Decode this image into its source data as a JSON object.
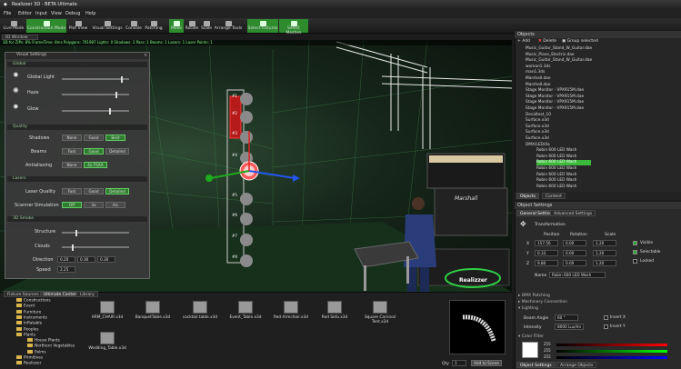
{
  "window": {
    "title": "Realizzer 3D - BETA Ultimate"
  },
  "menu": [
    "File",
    "Editor",
    "Input",
    "View",
    "Debug",
    "Help"
  ],
  "toolbar": {
    "buttons": [
      "Live Mode",
      "Construction Mode",
      "Plot View",
      "Visual Settings",
      "Console",
      "Patching",
      "Move",
      "Rotate",
      "Scale",
      "Arrange Tools",
      "Select Fixtures",
      "Select Meshes"
    ]
  },
  "viewport": {
    "tab": "3D Window",
    "status": "3D for ZIPs: 8% FrameTime: 8ms  Polygons: 701987  Lights: 0  Shadows: 3  Pass: 1  Beams: 1  Lasers: 1  Laser Points: 1",
    "logo_text": "Realizzer",
    "brand_text": "Marshall"
  },
  "visual_settings": {
    "title": "Visual Settings",
    "global_header": "Global",
    "global_labels": [
      "Global Light",
      "Haze",
      "Glow"
    ],
    "global_levels": [
      0.88,
      0.8,
      0.7
    ],
    "quality_header": "Quality",
    "shadows_label": "Shadows",
    "shadows_opts": [
      "None",
      "Good",
      "Best"
    ],
    "beams_label": "Beams",
    "beams_opts": [
      "Fast",
      "Good",
      "Detailed"
    ],
    "aa_label": "Antialiasing",
    "aa_opts": [
      "None",
      "4x FSAA"
    ],
    "lasers_header": "Lasers",
    "laser_quality_label": "Laser Quality",
    "laser_quality_opts": [
      "Fast",
      "Good",
      "Detailed"
    ],
    "scanner_label": "Scanner Simulation",
    "scanner_opts": [
      "Off",
      "3x",
      "Hx"
    ],
    "smoke_header": "3D Smoke",
    "smoke_labels": [
      "Structure",
      "Clouds",
      "Direction",
      "Speed"
    ],
    "direction_values": [
      "0.20",
      "0.30",
      "0.30"
    ],
    "speed_value": "2.25"
  },
  "objects": {
    "title": "Objects",
    "actions": [
      "Add",
      "Delete",
      "Group selected"
    ],
    "items": [
      "Music_Guitar_Stand_W_Guitar.dae",
      "Music_Piano_Electric.dae",
      "Music_Guitar_Stand_W_Guitar.dae",
      "woman1.3ds",
      "man1.3ds",
      "Marshall.dae",
      "Marshall.dae",
      "Stage Monitor - VPX915M.dae",
      "Stage Monitor - VPX915M.dae",
      "Stage Monitor - VPX915M.dae",
      "Stage Monitor - VPX915M.dae",
      "Decaltest_10",
      "Surface.x3d",
      "Surface.x3d",
      "Surface.x3d",
      "Surface.x3d",
      "DMX/LED/4a",
      "Robin 600 LED Wash",
      "Robin 600 LED Wash",
      "Robin 600 LED Wash",
      "Robin 600 LED Wash",
      "Robin 600 LED Wash",
      "Robin 600 LED Wash",
      "Robin 600 LED Wash"
    ],
    "selected_index": 19,
    "tabs": [
      "Objects",
      "Content"
    ]
  },
  "object_settings": {
    "title": "Object Settings",
    "tabs": [
      "General Settings",
      "Advanced Settings"
    ],
    "transformation_label": "Transformation",
    "col_headers": [
      "Position",
      "Rotation",
      "Scale"
    ],
    "axes": [
      "X",
      "Y",
      "Z"
    ],
    "position": [
      "157.56",
      "0.33",
      "9.80"
    ],
    "rotation": [
      "0.00",
      "0.00",
      "0.00"
    ],
    "scale": [
      "1.20",
      "1.20",
      "1.20"
    ],
    "checks": [
      "Visible",
      "Selectable",
      "Locked"
    ],
    "name_label": "Name",
    "name_value": "Robin 600 LED Wash",
    "collapsed_sections": [
      "DMX Patching",
      "Machinery Connection",
      "Lighting"
    ],
    "beam_angle_label": "Beam Angle",
    "beam_angle_value": "60 °",
    "intensity_label": "Intensity",
    "intensity_value": "8000 Lux/lm",
    "invert_labels": [
      "Invert X",
      "Invert Y"
    ],
    "color_filter_label": "Color Filter",
    "rgb_values": [
      "255",
      "255",
      "255"
    ],
    "bottom_tabs": [
      "Object Settings",
      "Arrange Objects"
    ]
  },
  "library": {
    "tabs": [
      "Fixture Sources",
      "Ultimate Content",
      "Library"
    ],
    "folders": [
      "Constructions",
      "Event",
      "Furniture",
      "Instruments",
      "Inflatable",
      "Peoples",
      "Plants",
      "House Plants",
      "Northern Vegetables",
      "Palms",
      "Primitives",
      "Realizzer"
    ],
    "assets": [
      "ARM_CHAIR.x3d",
      "BanquetTable.x3d",
      "cocktail.table.x3d",
      "Event_Table.x3d",
      "Red Armchair.x3d",
      "Red Sofa.x3d",
      "Square Carnival Tent.x3d",
      "Wedding_Table.x3d"
    ],
    "qty_label": "Qty",
    "qty_value": "1",
    "add_button": "Add to Scene"
  },
  "fixture_labels": [
    "#1",
    "#2",
    "#3",
    "#4",
    "#5",
    "#6",
    "#7",
    "#8"
  ],
  "colors": {
    "accent": "#3cba3c",
    "panel": "#3a3a3a",
    "background": "#1b1b1b"
  }
}
